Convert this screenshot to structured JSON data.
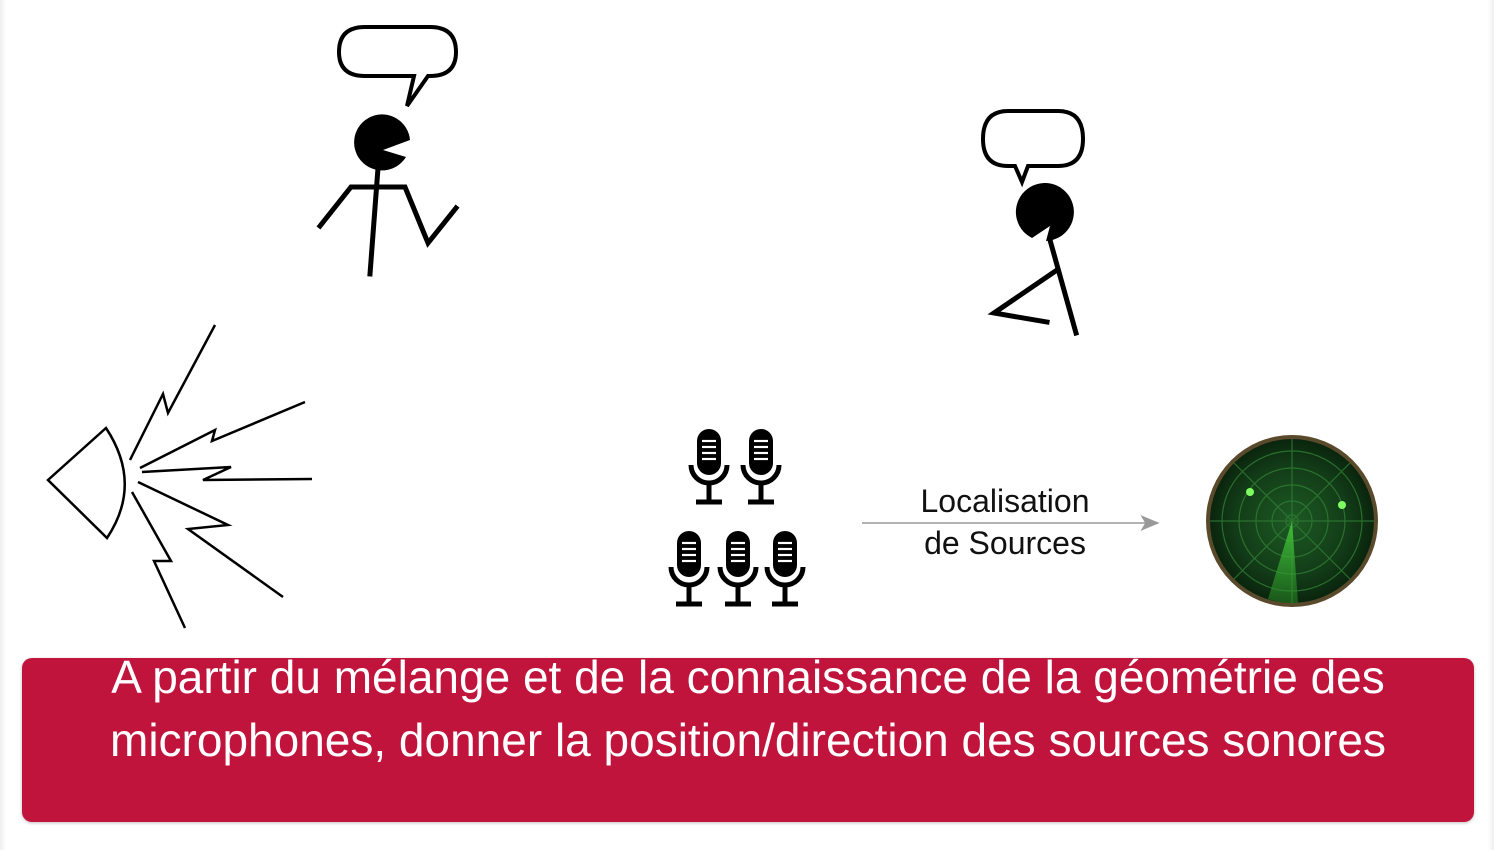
{
  "diagram": {
    "arrow_label_lines": [
      "Localisation",
      "de Sources"
    ],
    "caption": "A partir du mélange et de la connaissance de la géométrie des microphones, donner la position/direction des sources sonores"
  },
  "colors": {
    "banner": "#c0143c",
    "figure_ink": "#000000",
    "arrow": "#999999",
    "radar_bg": "#123b17",
    "radar_rim": "#4a3b22",
    "radar_sweep": "#43c93b",
    "radar_blip": "#7dff62"
  },
  "icons": {
    "speaker_1": "talking-stick-figure",
    "speaker_2": "talking-stick-figure",
    "noise_source": "loudspeaker-icon",
    "microphone_array": "microphone-icon",
    "output": "radar-icon"
  }
}
